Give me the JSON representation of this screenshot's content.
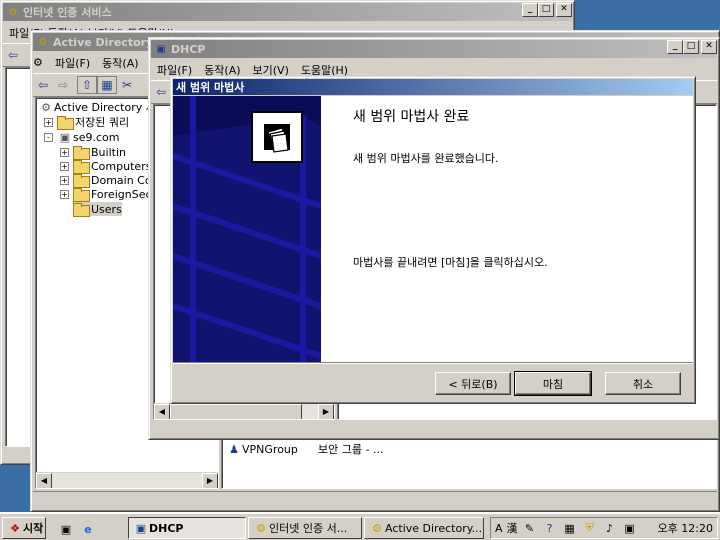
{
  "windows": {
    "ias": {
      "title": "인터넷 인증 서비스",
      "menu_partial": "파일(F)  동작(A)  보기(V)  도움말(H)"
    },
    "ad": {
      "title": "Active Directory 사용자 및 컴퓨터",
      "menu": [
        "파일(F)",
        "동작(A)"
      ],
      "tree": [
        {
          "label": "Active Directory 사용자 및 컴퓨터",
          "indent": 0,
          "expander": ""
        },
        {
          "label": "저장된 쿼리",
          "indent": 1,
          "expander": "+"
        },
        {
          "label": "se9.com",
          "indent": 1,
          "expander": "-"
        },
        {
          "label": "Builtin",
          "indent": 2,
          "expander": "+"
        },
        {
          "label": "Computers",
          "indent": 2,
          "expander": "+"
        },
        {
          "label": "Domain Controllers",
          "indent": 2,
          "expander": "+"
        },
        {
          "label": "ForeignSecurityPrincipals",
          "indent": 2,
          "expander": "+"
        },
        {
          "label": "Users",
          "indent": 2,
          "expander": ""
        }
      ],
      "list_row": {
        "name": "VPNGroup",
        "type": "보안 그룹 - ..."
      }
    },
    "dhcp": {
      "title": "DHCP",
      "menu": [
        "파일(F)",
        "동작(A)",
        "보기(V)",
        "도움말(H)"
      ]
    }
  },
  "wizard": {
    "title": "새 범위 마법사",
    "heading": "새 범위 마법사 완료",
    "line1": "새 범위 마법사를 완료했습니다.",
    "line2": "마법사를 끝내려면 [마침]을 클릭하십시오.",
    "back_button": "< 뒤로(B)",
    "finish_button": "마침",
    "cancel_button": "취소"
  },
  "taskbar": {
    "start": "시작",
    "tasks": [
      "DHCP",
      "인터넷 인증 서...",
      "Active Directory..."
    ],
    "ime": [
      "A",
      "漢"
    ],
    "clock": "오후 12:20"
  }
}
